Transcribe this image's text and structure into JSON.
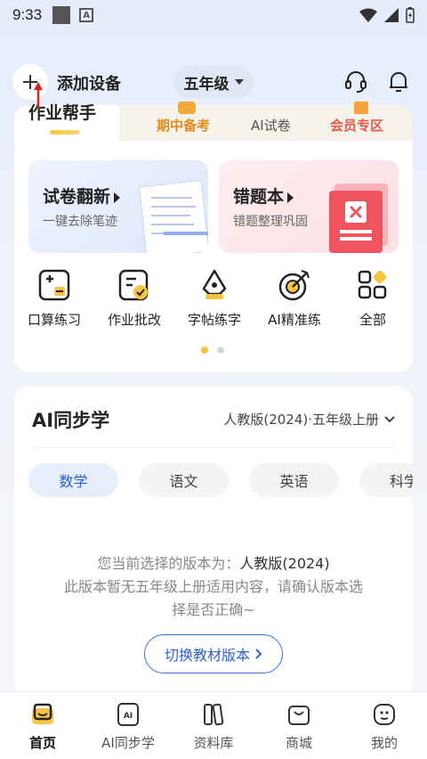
{
  "status": {
    "time": "9:33"
  },
  "header": {
    "add_device_label": "添加设备",
    "grade_label": "五年级"
  },
  "helper": {
    "active_tab": "作业帮手",
    "tabs": [
      "期中备考",
      "AI试卷",
      "会员专区"
    ],
    "cards": [
      {
        "title": "试卷翻新",
        "subtitle": "一键去除笔迹"
      },
      {
        "title": "错题本",
        "subtitle": "错题整理巩固"
      }
    ],
    "tools": [
      {
        "label": "口算练习",
        "icon": "calc-icon"
      },
      {
        "label": "作业批改",
        "icon": "check-icon"
      },
      {
        "label": "字帖练字",
        "icon": "pen-icon"
      },
      {
        "label": "AI精准练",
        "icon": "target-icon"
      },
      {
        "label": "全部",
        "icon": "grid-icon"
      }
    ],
    "page_indicator": {
      "count": 2,
      "active": 0
    }
  },
  "ai_sync": {
    "title": "AI同步学",
    "version_label": "人教版(2024)·五年级上册",
    "subjects": [
      "数学",
      "语文",
      "英语",
      "科学"
    ],
    "active_subject": 0,
    "message_prefix": "您当前选择的版本为：",
    "message_version": "人教版(2024)",
    "message_line2": "此版本暂无五年级上册适用内容，请确认版本选",
    "message_line3": "择是否正确~",
    "switch_button": "切换教材版本"
  },
  "nav": {
    "items": [
      {
        "label": "首页",
        "icon": "home-icon",
        "active": true
      },
      {
        "label": "AI同步学",
        "icon": "ai-book-icon",
        "active": false
      },
      {
        "label": "资料库",
        "icon": "library-icon",
        "active": false
      },
      {
        "label": "商城",
        "icon": "shop-icon",
        "active": false
      },
      {
        "label": "我的",
        "icon": "profile-icon",
        "active": false
      }
    ]
  },
  "colors": {
    "accent_blue": "#3c6fd8",
    "active_subject_bg": "#e6eefc",
    "inactive_subject_bg": "#f3f4f6",
    "dot_active": "#f7c542",
    "dot_inactive": "#d6d6d6"
  }
}
